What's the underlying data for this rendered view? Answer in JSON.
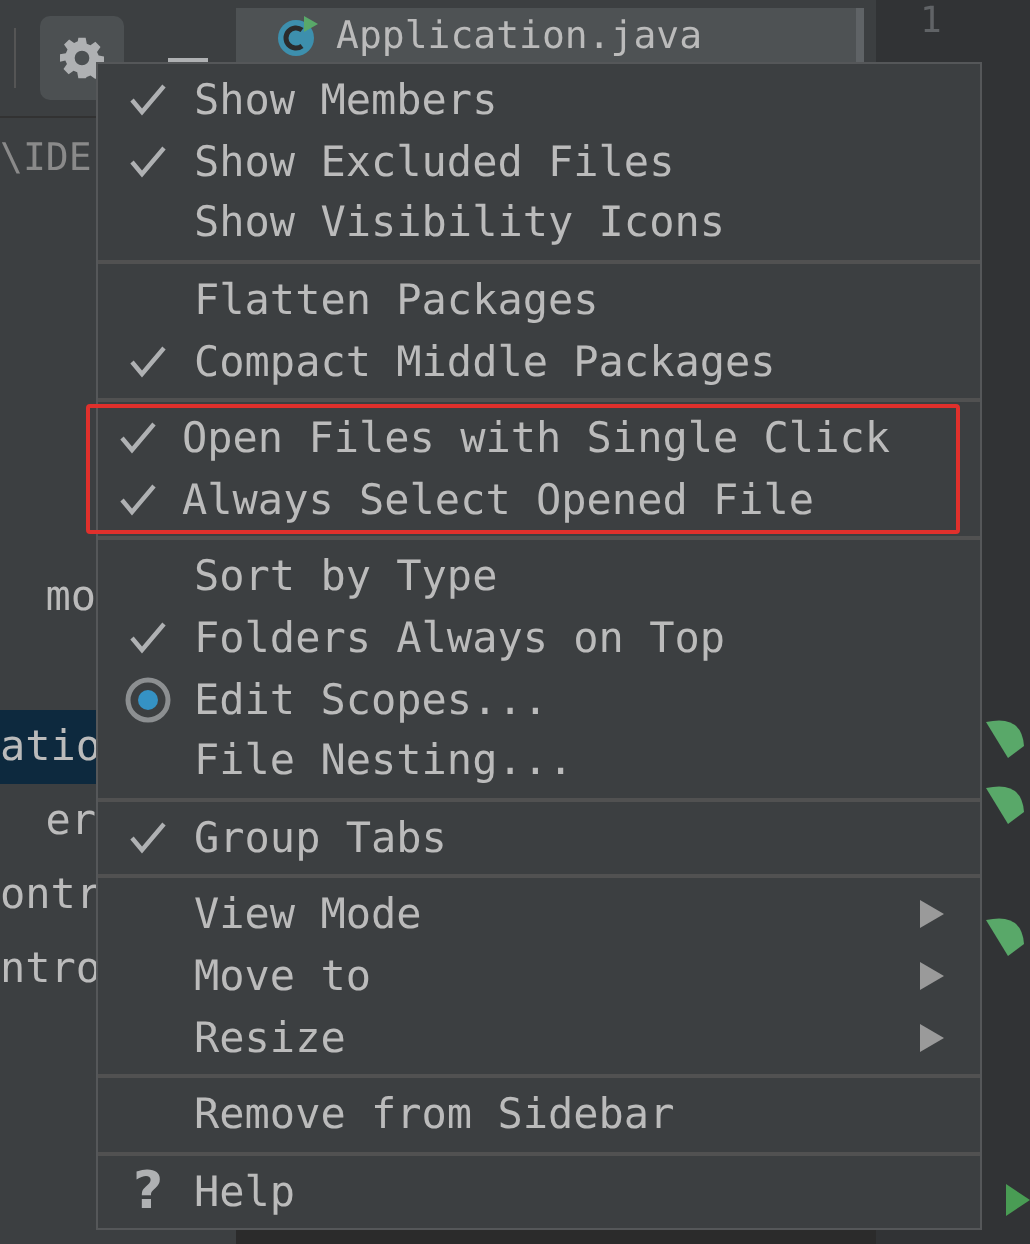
{
  "project_panel": {
    "path": "\\IDE",
    "rows": [
      {
        "label": "mo",
        "selected": false
      },
      {
        "label": "atio",
        "selected": true
      },
      {
        "label": "er",
        "selected": false
      },
      {
        "label": "ontr",
        "selected": false
      },
      {
        "label": "ntro",
        "selected": false
      }
    ]
  },
  "editor": {
    "tab": {
      "label": "Application.java"
    },
    "line_number": "1"
  },
  "menu": {
    "groups": [
      {
        "highlighted": false,
        "items": [
          {
            "kind": "check",
            "label": "Show Members",
            "checked": true
          },
          {
            "kind": "check",
            "label": "Show Excluded Files",
            "checked": true
          },
          {
            "kind": "check",
            "label": "Show Visibility Icons",
            "checked": false
          }
        ]
      },
      {
        "highlighted": false,
        "items": [
          {
            "kind": "check",
            "label": "Flatten Packages",
            "checked": false
          },
          {
            "kind": "check",
            "label": "Compact Middle Packages",
            "checked": true
          }
        ]
      },
      {
        "highlighted": true,
        "items": [
          {
            "kind": "check",
            "label": "Open Files with Single Click",
            "checked": true
          },
          {
            "kind": "check",
            "label": "Always Select Opened File",
            "checked": true
          }
        ]
      },
      {
        "highlighted": false,
        "items": [
          {
            "kind": "check",
            "label": "Sort by Type",
            "checked": false
          },
          {
            "kind": "check",
            "label": "Folders Always on Top",
            "checked": true
          },
          {
            "kind": "radio",
            "label": "Edit Scopes...",
            "checked": true
          },
          {
            "kind": "plain",
            "label": "File Nesting..."
          }
        ]
      },
      {
        "highlighted": false,
        "items": [
          {
            "kind": "check",
            "label": "Group Tabs",
            "checked": true
          }
        ]
      },
      {
        "highlighted": false,
        "items": [
          {
            "kind": "submenu",
            "label": "View Mode"
          },
          {
            "kind": "submenu",
            "label": "Move to"
          },
          {
            "kind": "submenu",
            "label": "Resize"
          }
        ]
      },
      {
        "highlighted": false,
        "items": [
          {
            "kind": "plain",
            "label": "Remove from Sidebar"
          }
        ]
      },
      {
        "highlighted": false,
        "items": [
          {
            "kind": "help",
            "icon": "?",
            "label": "Help"
          }
        ]
      }
    ]
  }
}
